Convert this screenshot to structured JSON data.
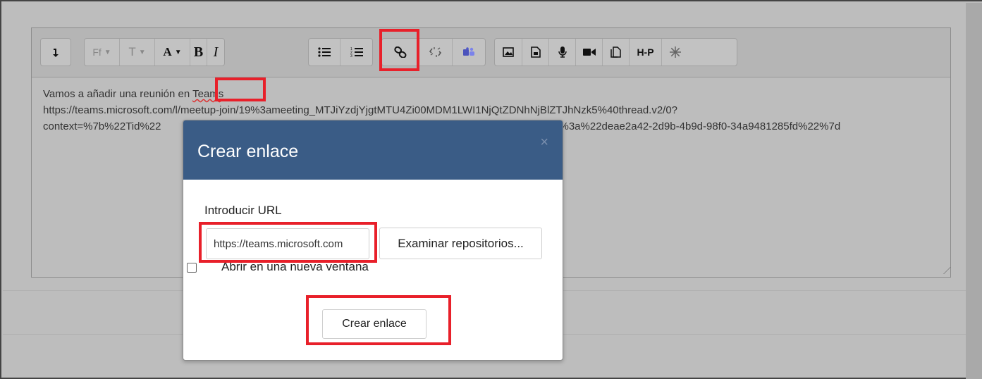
{
  "editor": {
    "toolbar": {
      "font_family_label": "Ff",
      "font_size_label": "T",
      "font_color_label": "A",
      "bold_label": "B",
      "italic_label": "I",
      "h5p_label": "H-P"
    },
    "content": {
      "line1_prefix": "Vamos a añadir una reunión en ",
      "line1_link": "Teams",
      "line2": "https://teams.microsoft.com/l/meetup-join/19%3ameeting_MTJiYzdjYjgtMTU4Zi00MDM1LWI1NjQtZDNhNjBlZTJhNzk5%40thread.v2/0?",
      "line3_left": "context=%7b%22Tid%22",
      "line3_right": "%22%3a%22deae2a42-2d9b-4b9d-98f0-34a9481285fd%22%7d"
    }
  },
  "modal": {
    "title": "Crear enlace",
    "close_glyph": "×",
    "url_label": "Introducir URL",
    "url_value": "https://teams.microsoft.com",
    "browse_label": "Examinar repositorios...",
    "new_window_label": "Abrir en una nueva ventana",
    "new_window_checked": false,
    "submit_label": "Crear enlace"
  },
  "colors": {
    "modal_header": "#3a5c86",
    "highlight": "#e8202a",
    "overlay": "#bdbdbd"
  }
}
